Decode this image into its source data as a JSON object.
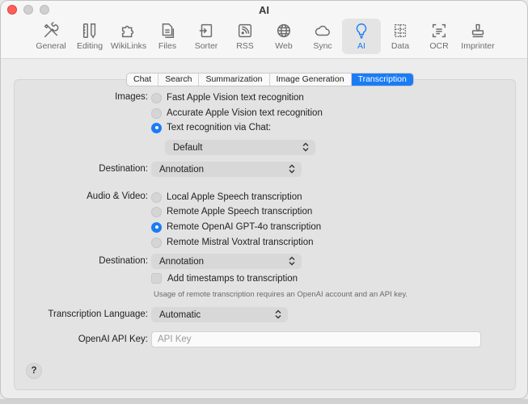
{
  "window": {
    "title": "AI"
  },
  "toolbar": [
    {
      "id": "general",
      "label": "General",
      "icon": "tools-icon"
    },
    {
      "id": "editing",
      "label": "Editing",
      "icon": "pencil-ruler-icon"
    },
    {
      "id": "wikilinks",
      "label": "WikiLinks",
      "icon": "puzzle-icon"
    },
    {
      "id": "files",
      "label": "Files",
      "icon": "documents-icon"
    },
    {
      "id": "sorter",
      "label": "Sorter",
      "icon": "sorter-icon"
    },
    {
      "id": "rss",
      "label": "RSS",
      "icon": "rss-icon"
    },
    {
      "id": "web",
      "label": "Web",
      "icon": "globe-icon"
    },
    {
      "id": "sync",
      "label": "Sync",
      "icon": "cloud-icon"
    },
    {
      "id": "ai",
      "label": "AI",
      "icon": "lightbulb-icon",
      "active": true
    },
    {
      "id": "data",
      "label": "Data",
      "icon": "data-grid-icon"
    },
    {
      "id": "ocr",
      "label": "OCR",
      "icon": "ocr-scan-icon"
    },
    {
      "id": "imprinter",
      "label": "Imprinter",
      "icon": "stamp-icon"
    }
  ],
  "tabs": [
    "Chat",
    "Search",
    "Summarization",
    "Image Generation",
    "Transcription"
  ],
  "active_tab": "Transcription",
  "images": {
    "label": "Images:",
    "options": [
      "Fast Apple Vision text recognition",
      "Accurate Apple Vision text recognition",
      "Text recognition via Chat:"
    ],
    "selected_index": 2,
    "model_select": "Default",
    "destination_label": "Destination:",
    "destination_value": "Annotation"
  },
  "audio_video": {
    "label": "Audio & Video:",
    "options": [
      "Local Apple Speech transcription",
      "Remote Apple Speech transcription",
      "Remote OpenAI GPT-4o transcription",
      "Remote Mistral Voxtral transcription"
    ],
    "selected_index": 2,
    "destination_label": "Destination:",
    "destination_value": "Annotation",
    "timestamps_label": "Add timestamps to transcription",
    "timestamps_checked": false,
    "note": "Usage of remote transcription requires an OpenAI account and an API key."
  },
  "language": {
    "label": "Transcription Language:",
    "value": "Automatic"
  },
  "api_key": {
    "label": "OpenAI API Key:",
    "value": "",
    "placeholder": "API Key"
  },
  "help": {
    "label": "?"
  },
  "colors": {
    "accent": "#1a7cf5",
    "close": "#fe5f57"
  }
}
